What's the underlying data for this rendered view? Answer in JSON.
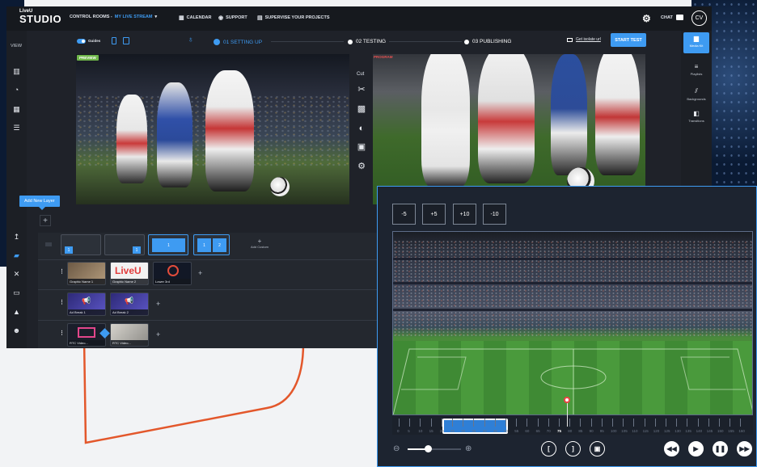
{
  "app": {
    "logo_top": "LiveU",
    "logo_bottom": "STUDIO",
    "control_rooms_label": "CONTROL ROOMS - ",
    "stream_name": "MY LIVE STREAM",
    "calendar": "CALENDAR",
    "support": "SUPPORT",
    "supervise": "SUPERVISE YOUR PROJECTS",
    "chat": "CHAT",
    "avatar_initials": "CV"
  },
  "sidebar": {
    "view_label": "VIEW"
  },
  "toolbar": {
    "guides": "Guides",
    "steps": [
      {
        "label": "01  SETTING UP"
      },
      {
        "label": "02  TESTING"
      },
      {
        "label": "03  PUBLISHING"
      }
    ],
    "isolate_link": "Get isolate url",
    "start_test": "START TEST"
  },
  "right_panel": {
    "items": [
      {
        "label": "Media Kit"
      },
      {
        "label": "Playlists"
      },
      {
        "label": "Backgrounds"
      },
      {
        "label": "Transitions"
      }
    ]
  },
  "preview": {
    "badge": "PREVIEW"
  },
  "program": {
    "badge": "PROGRAM"
  },
  "cut_label": "Cut",
  "add_layer_tooltip": "Add New Layer",
  "scenes": {
    "tiles": [
      "1",
      "1",
      "1",
      "1",
      "2"
    ],
    "add_custom": "Add Custom"
  },
  "graphics_row": [
    "Graphic Name 1",
    "Graphic Name 2",
    "Lower 3rd"
  ],
  "ad_row": [
    "Ad Break 1",
    "Ad Break 2"
  ],
  "rtc_row": [
    "RTC Video...",
    "RTC Video..."
  ],
  "editor": {
    "jumps": [
      "-5",
      "+5",
      "+10",
      "-10"
    ],
    "timeline_ticks": [
      "0",
      "5",
      "10",
      "15",
      "20",
      "25",
      "30",
      "35",
      "40",
      "45",
      "50",
      "55",
      "60",
      "65",
      "70",
      "75",
      "80",
      "85",
      "90",
      "95",
      "100",
      "105",
      "110",
      "115",
      "120",
      "125",
      "130",
      "135",
      "140",
      "145",
      "150",
      "155",
      "160"
    ],
    "playhead_value": "75",
    "controls": {
      "in": "[",
      "out": "]"
    }
  },
  "colors": {
    "accent": "#3e9bf2",
    "curve": "#e3572b",
    "editor_bg": "#1d2430"
  }
}
